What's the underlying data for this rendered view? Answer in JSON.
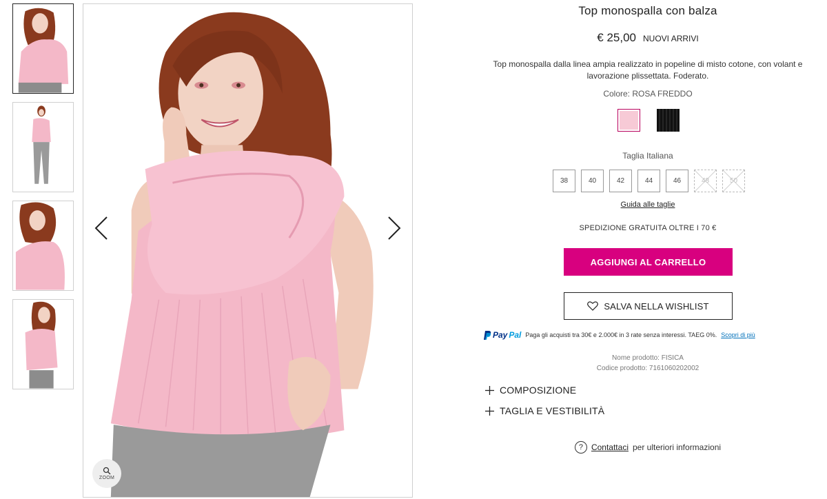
{
  "product": {
    "title": "Top monospalla con balza",
    "price": "€ 25,00",
    "badge": "NUOVI ARRIVI",
    "description": "Top monospalla dalla linea ampia realizzato in popeline di misto cotone, con volant e lavorazione plissettata. Foderato.",
    "color_label": "Colore: ROSA FREDDO",
    "colors": [
      {
        "name": "rosa-freddo",
        "hex": "#f7cad6"
      },
      {
        "name": "nero",
        "hex": "#111111"
      }
    ],
    "size_label": "Taglia Italiana",
    "sizes": [
      "38",
      "40",
      "42",
      "44",
      "46",
      "48",
      "50"
    ],
    "size_guide": "Guida alle taglie",
    "shipping": "SPEDIZIONE GRATUITA OLTRE I 70 €",
    "add_to_cart": "AGGIUNGI AL CARRELLO",
    "wishlist": "SALVA NELLA WISHLIST",
    "paypal": {
      "logo_pay": "Pay",
      "logo_pal": "Pal",
      "text": "Paga gli acquisti tra 30€ e 2.000€ in 3 rate senza interessi. TAEG 0%.",
      "link": "Scopri di più"
    },
    "product_name": "Nome prodotto: FISICA",
    "product_code": "Codice prodotto:  7161060202002",
    "accordions": [
      "COMPOSIZIONE",
      "TAGLIA E VESTIBILITÀ"
    ],
    "contact_link": "Contattaci",
    "contact_text": "per ulteriori informazioni"
  },
  "gallery": {
    "zoom_label": "ZOOM",
    "thumbnail_count": 4
  },
  "colors": {
    "accent": "#d8007f",
    "top_pink": "#f4b8c8",
    "hair": "#8a3a1e"
  }
}
